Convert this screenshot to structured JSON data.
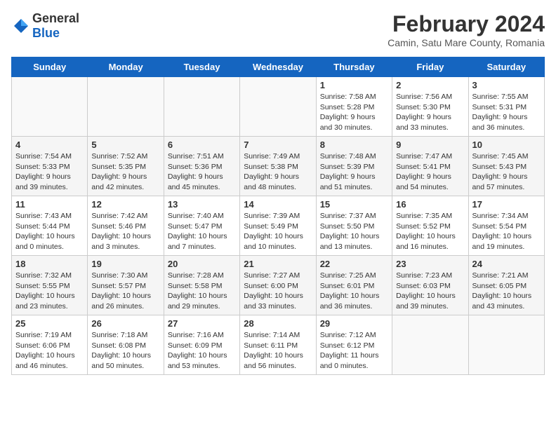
{
  "header": {
    "logo_general": "General",
    "logo_blue": "Blue",
    "month": "February 2024",
    "location": "Camin, Satu Mare County, Romania"
  },
  "days_of_week": [
    "Sunday",
    "Monday",
    "Tuesday",
    "Wednesday",
    "Thursday",
    "Friday",
    "Saturday"
  ],
  "weeks": [
    [
      {
        "day": "",
        "info": ""
      },
      {
        "day": "",
        "info": ""
      },
      {
        "day": "",
        "info": ""
      },
      {
        "day": "",
        "info": ""
      },
      {
        "day": "1",
        "info": "Sunrise: 7:58 AM\nSunset: 5:28 PM\nDaylight: 9 hours and 30 minutes."
      },
      {
        "day": "2",
        "info": "Sunrise: 7:56 AM\nSunset: 5:30 PM\nDaylight: 9 hours and 33 minutes."
      },
      {
        "day": "3",
        "info": "Sunrise: 7:55 AM\nSunset: 5:31 PM\nDaylight: 9 hours and 36 minutes."
      }
    ],
    [
      {
        "day": "4",
        "info": "Sunrise: 7:54 AM\nSunset: 5:33 PM\nDaylight: 9 hours and 39 minutes."
      },
      {
        "day": "5",
        "info": "Sunrise: 7:52 AM\nSunset: 5:35 PM\nDaylight: 9 hours and 42 minutes."
      },
      {
        "day": "6",
        "info": "Sunrise: 7:51 AM\nSunset: 5:36 PM\nDaylight: 9 hours and 45 minutes."
      },
      {
        "day": "7",
        "info": "Sunrise: 7:49 AM\nSunset: 5:38 PM\nDaylight: 9 hours and 48 minutes."
      },
      {
        "day": "8",
        "info": "Sunrise: 7:48 AM\nSunset: 5:39 PM\nDaylight: 9 hours and 51 minutes."
      },
      {
        "day": "9",
        "info": "Sunrise: 7:47 AM\nSunset: 5:41 PM\nDaylight: 9 hours and 54 minutes."
      },
      {
        "day": "10",
        "info": "Sunrise: 7:45 AM\nSunset: 5:43 PM\nDaylight: 9 hours and 57 minutes."
      }
    ],
    [
      {
        "day": "11",
        "info": "Sunrise: 7:43 AM\nSunset: 5:44 PM\nDaylight: 10 hours and 0 minutes."
      },
      {
        "day": "12",
        "info": "Sunrise: 7:42 AM\nSunset: 5:46 PM\nDaylight: 10 hours and 3 minutes."
      },
      {
        "day": "13",
        "info": "Sunrise: 7:40 AM\nSunset: 5:47 PM\nDaylight: 10 hours and 7 minutes."
      },
      {
        "day": "14",
        "info": "Sunrise: 7:39 AM\nSunset: 5:49 PM\nDaylight: 10 hours and 10 minutes."
      },
      {
        "day": "15",
        "info": "Sunrise: 7:37 AM\nSunset: 5:50 PM\nDaylight: 10 hours and 13 minutes."
      },
      {
        "day": "16",
        "info": "Sunrise: 7:35 AM\nSunset: 5:52 PM\nDaylight: 10 hours and 16 minutes."
      },
      {
        "day": "17",
        "info": "Sunrise: 7:34 AM\nSunset: 5:54 PM\nDaylight: 10 hours and 19 minutes."
      }
    ],
    [
      {
        "day": "18",
        "info": "Sunrise: 7:32 AM\nSunset: 5:55 PM\nDaylight: 10 hours and 23 minutes."
      },
      {
        "day": "19",
        "info": "Sunrise: 7:30 AM\nSunset: 5:57 PM\nDaylight: 10 hours and 26 minutes."
      },
      {
        "day": "20",
        "info": "Sunrise: 7:28 AM\nSunset: 5:58 PM\nDaylight: 10 hours and 29 minutes."
      },
      {
        "day": "21",
        "info": "Sunrise: 7:27 AM\nSunset: 6:00 PM\nDaylight: 10 hours and 33 minutes."
      },
      {
        "day": "22",
        "info": "Sunrise: 7:25 AM\nSunset: 6:01 PM\nDaylight: 10 hours and 36 minutes."
      },
      {
        "day": "23",
        "info": "Sunrise: 7:23 AM\nSunset: 6:03 PM\nDaylight: 10 hours and 39 minutes."
      },
      {
        "day": "24",
        "info": "Sunrise: 7:21 AM\nSunset: 6:05 PM\nDaylight: 10 hours and 43 minutes."
      }
    ],
    [
      {
        "day": "25",
        "info": "Sunrise: 7:19 AM\nSunset: 6:06 PM\nDaylight: 10 hours and 46 minutes."
      },
      {
        "day": "26",
        "info": "Sunrise: 7:18 AM\nSunset: 6:08 PM\nDaylight: 10 hours and 50 minutes."
      },
      {
        "day": "27",
        "info": "Sunrise: 7:16 AM\nSunset: 6:09 PM\nDaylight: 10 hours and 53 minutes."
      },
      {
        "day": "28",
        "info": "Sunrise: 7:14 AM\nSunset: 6:11 PM\nDaylight: 10 hours and 56 minutes."
      },
      {
        "day": "29",
        "info": "Sunrise: 7:12 AM\nSunset: 6:12 PM\nDaylight: 11 hours and 0 minutes."
      },
      {
        "day": "",
        "info": ""
      },
      {
        "day": "",
        "info": ""
      }
    ]
  ]
}
